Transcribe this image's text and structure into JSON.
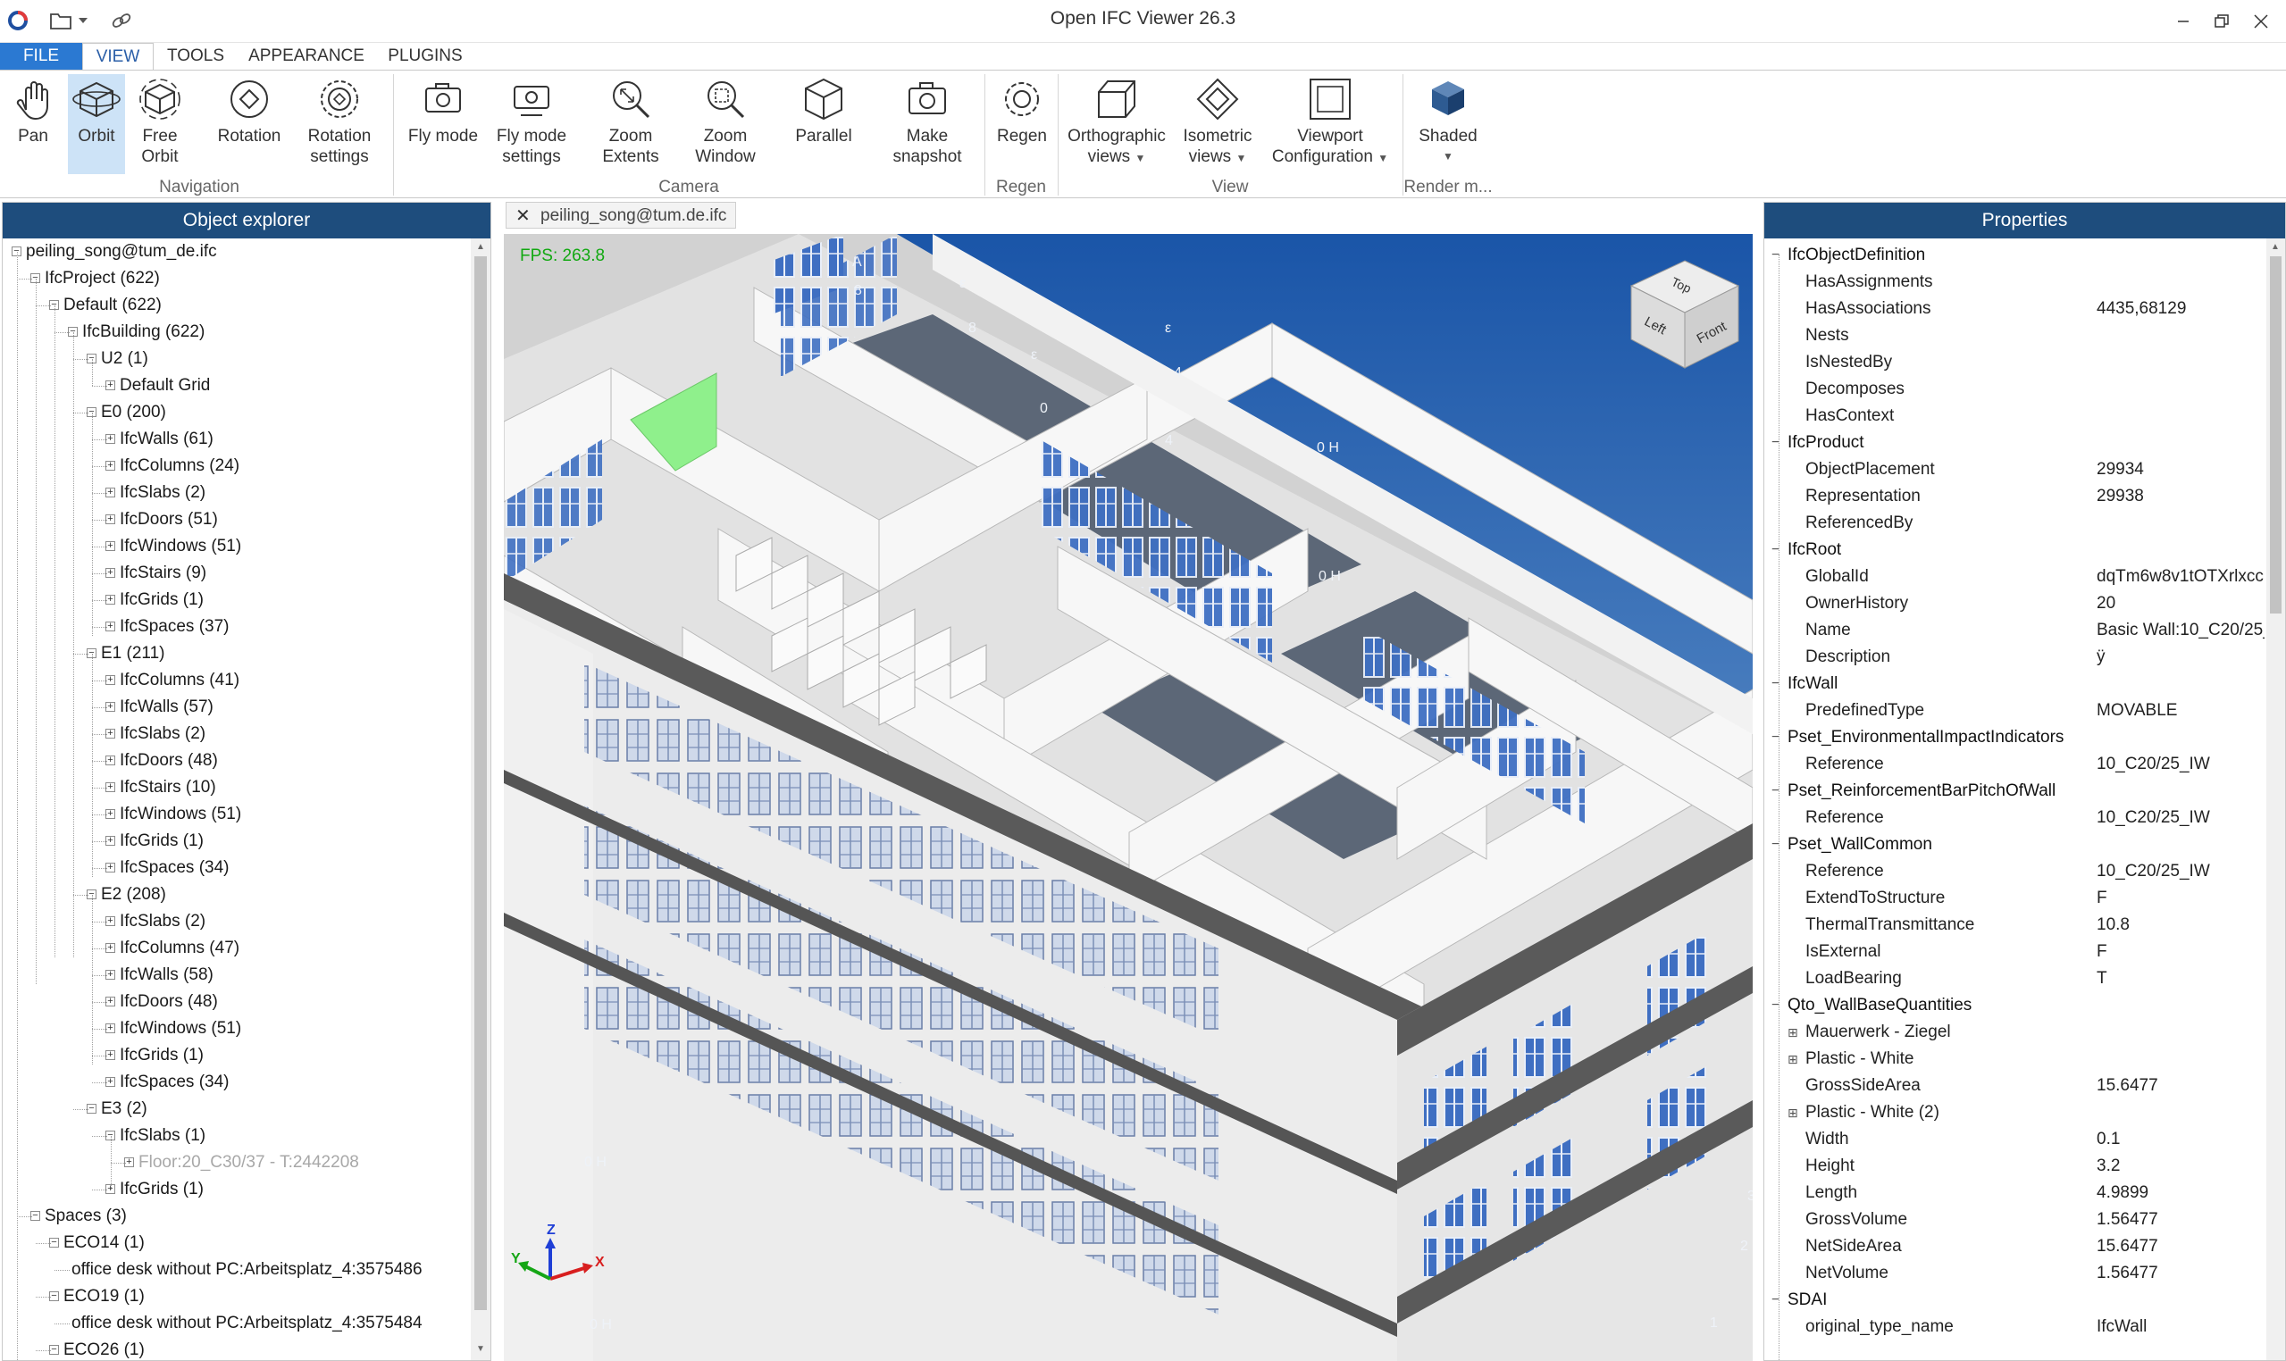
{
  "window": {
    "title": "Open IFC Viewer 26.3"
  },
  "menu": {
    "tabs": [
      "FILE",
      "VIEW",
      "TOOLS",
      "APPEARANCE",
      "PLUGINS"
    ],
    "active": "VIEW"
  },
  "ribbon": {
    "buttons": {
      "pan": "Pan",
      "orbit": "Orbit",
      "free_orbit_1": "Free",
      "free_orbit_2": "Orbit",
      "rotation": "Rotation",
      "rotation_settings_1": "Rotation",
      "rotation_settings_2": "settings",
      "fly_mode": "Fly mode",
      "fly_mode_settings_1": "Fly mode",
      "fly_mode_settings_2": "settings",
      "zoom_extents_1": "Zoom",
      "zoom_extents_2": "Extents",
      "zoom_window_1": "Zoom",
      "zoom_window_2": "Window",
      "parallel": "Parallel",
      "make_snapshot_1": "Make",
      "make_snapshot_2": "snapshot",
      "regen": "Regen",
      "orthographic_1": "Orthographic",
      "orthographic_2": "views",
      "isometric_1": "Isometric",
      "isometric_2": "views",
      "viewport_config_1": "Viewport",
      "viewport_config_2": "Configuration",
      "shaded": "Shaded"
    },
    "groups": {
      "navigation": "Navigation",
      "camera": "Camera",
      "regen": "Regen",
      "view": "View",
      "render": "Render m..."
    }
  },
  "explorer": {
    "title": "Object explorer",
    "nodes": [
      {
        "label": "peiling_song@tum_de.ifc"
      },
      {
        "label": "IfcProject (622)"
      },
      {
        "label": "Default (622)"
      },
      {
        "label": "IfcBuilding (622)"
      },
      {
        "label": "U2 (1)"
      },
      {
        "label": "Default Grid"
      },
      {
        "label": "E0 (200)"
      },
      {
        "label": "IfcWalls (61)"
      },
      {
        "label": "IfcColumns (24)"
      },
      {
        "label": "IfcSlabs (2)"
      },
      {
        "label": "IfcDoors (51)"
      },
      {
        "label": "IfcWindows (51)"
      },
      {
        "label": "IfcStairs (9)"
      },
      {
        "label": "IfcGrids (1)"
      },
      {
        "label": "IfcSpaces (37)"
      },
      {
        "label": "E1 (211)"
      },
      {
        "label": "IfcColumns (41)"
      },
      {
        "label": "IfcWalls (57)"
      },
      {
        "label": "IfcSlabs (2)"
      },
      {
        "label": "IfcDoors (48)"
      },
      {
        "label": "IfcStairs (10)"
      },
      {
        "label": "IfcWindows (51)"
      },
      {
        "label": "IfcGrids (1)"
      },
      {
        "label": "IfcSpaces (34)"
      },
      {
        "label": "E2 (208)"
      },
      {
        "label": "IfcSlabs (2)"
      },
      {
        "label": "IfcColumns (47)"
      },
      {
        "label": "IfcWalls (58)"
      },
      {
        "label": "IfcDoors (48)"
      },
      {
        "label": "IfcWindows (51)"
      },
      {
        "label": "IfcGrids (1)"
      },
      {
        "label": "IfcSpaces (34)"
      },
      {
        "label": "E3 (2)"
      },
      {
        "label": "IfcSlabs (1)"
      },
      {
        "label": "Floor:20_C30/37 - T:2442208"
      },
      {
        "label": "IfcGrids (1)"
      },
      {
        "label": "Spaces (3)"
      },
      {
        "label": "ECO14 (1)"
      },
      {
        "label": "office desk without PC:Arbeitsplatz_4:3575486"
      },
      {
        "label": "ECO19 (1)"
      },
      {
        "label": "office desk without PC:Arbeitsplatz_4:3575484"
      },
      {
        "label": "ECO26 (1)"
      }
    ]
  },
  "viewport": {
    "doc_tab": "peiling_song@tum.de.ifc",
    "fps": "FPS: 263.8",
    "viewcube": {
      "top": "Top",
      "left": "Left",
      "front": "Front"
    },
    "axes": {
      "x": "X",
      "y": "Y",
      "z": "Z"
    },
    "highlight_color": "#8ff08c",
    "sky_top": "#1a55a8",
    "sky_bottom": "#c4d7ea"
  },
  "properties": {
    "title": "Properties",
    "rows": [
      {
        "key": "IfcObjectDefinition",
        "value": ""
      },
      {
        "key": "HasAssignments",
        "value": ""
      },
      {
        "key": "HasAssociations",
        "value": "4435,68129"
      },
      {
        "key": "Nests",
        "value": ""
      },
      {
        "key": "IsNestedBy",
        "value": ""
      },
      {
        "key": "Decomposes",
        "value": ""
      },
      {
        "key": "HasContext",
        "value": ""
      },
      {
        "key": "IfcProduct",
        "value": ""
      },
      {
        "key": "ObjectPlacement",
        "value": "29934"
      },
      {
        "key": "Representation",
        "value": "29938"
      },
      {
        "key": "ReferencedBy",
        "value": ""
      },
      {
        "key": "IfcRoot",
        "value": ""
      },
      {
        "key": "GlobalId",
        "value": "dqTm6w8v1tOTXrlxcc"
      },
      {
        "key": "OwnerHistory",
        "value": "20"
      },
      {
        "key": "Name",
        "value": "Basic Wall:10_C20/25_"
      },
      {
        "key": "Description",
        "value": "ÿ"
      },
      {
        "key": "IfcWall",
        "value": ""
      },
      {
        "key": "PredefinedType",
        "value": "MOVABLE"
      },
      {
        "key": "Pset_EnvironmentalImpactIndicators",
        "value": ""
      },
      {
        "key": "Reference",
        "value": "10_C20/25_IW"
      },
      {
        "key": "Pset_ReinforcementBarPitchOfWall",
        "value": ""
      },
      {
        "key": "Reference",
        "value": "10_C20/25_IW"
      },
      {
        "key": "Pset_WallCommon",
        "value": ""
      },
      {
        "key": "Reference",
        "value": "10_C20/25_IW"
      },
      {
        "key": "ExtendToStructure",
        "value": "F"
      },
      {
        "key": "ThermalTransmittance",
        "value": "10.8"
      },
      {
        "key": "IsExternal",
        "value": "F"
      },
      {
        "key": "LoadBearing",
        "value": "T"
      },
      {
        "key": "Qto_WallBaseQuantities",
        "value": ""
      },
      {
        "key": "Mauerwerk - Ziegel",
        "value": ""
      },
      {
        "key": "Plastic - White",
        "value": ""
      },
      {
        "key": "GrossSideArea",
        "value": "15.6477"
      },
      {
        "key": "Plastic - White (2)",
        "value": ""
      },
      {
        "key": "Width",
        "value": "0.1"
      },
      {
        "key": "Height",
        "value": "3.2"
      },
      {
        "key": "Length",
        "value": "4.9899"
      },
      {
        "key": "GrossVolume",
        "value": "1.56477"
      },
      {
        "key": "NetSideArea",
        "value": "15.6477"
      },
      {
        "key": "NetVolume",
        "value": "1.56477"
      },
      {
        "key": "SDAI",
        "value": ""
      },
      {
        "key": "original_type_name",
        "value": "IfcWall"
      }
    ]
  }
}
